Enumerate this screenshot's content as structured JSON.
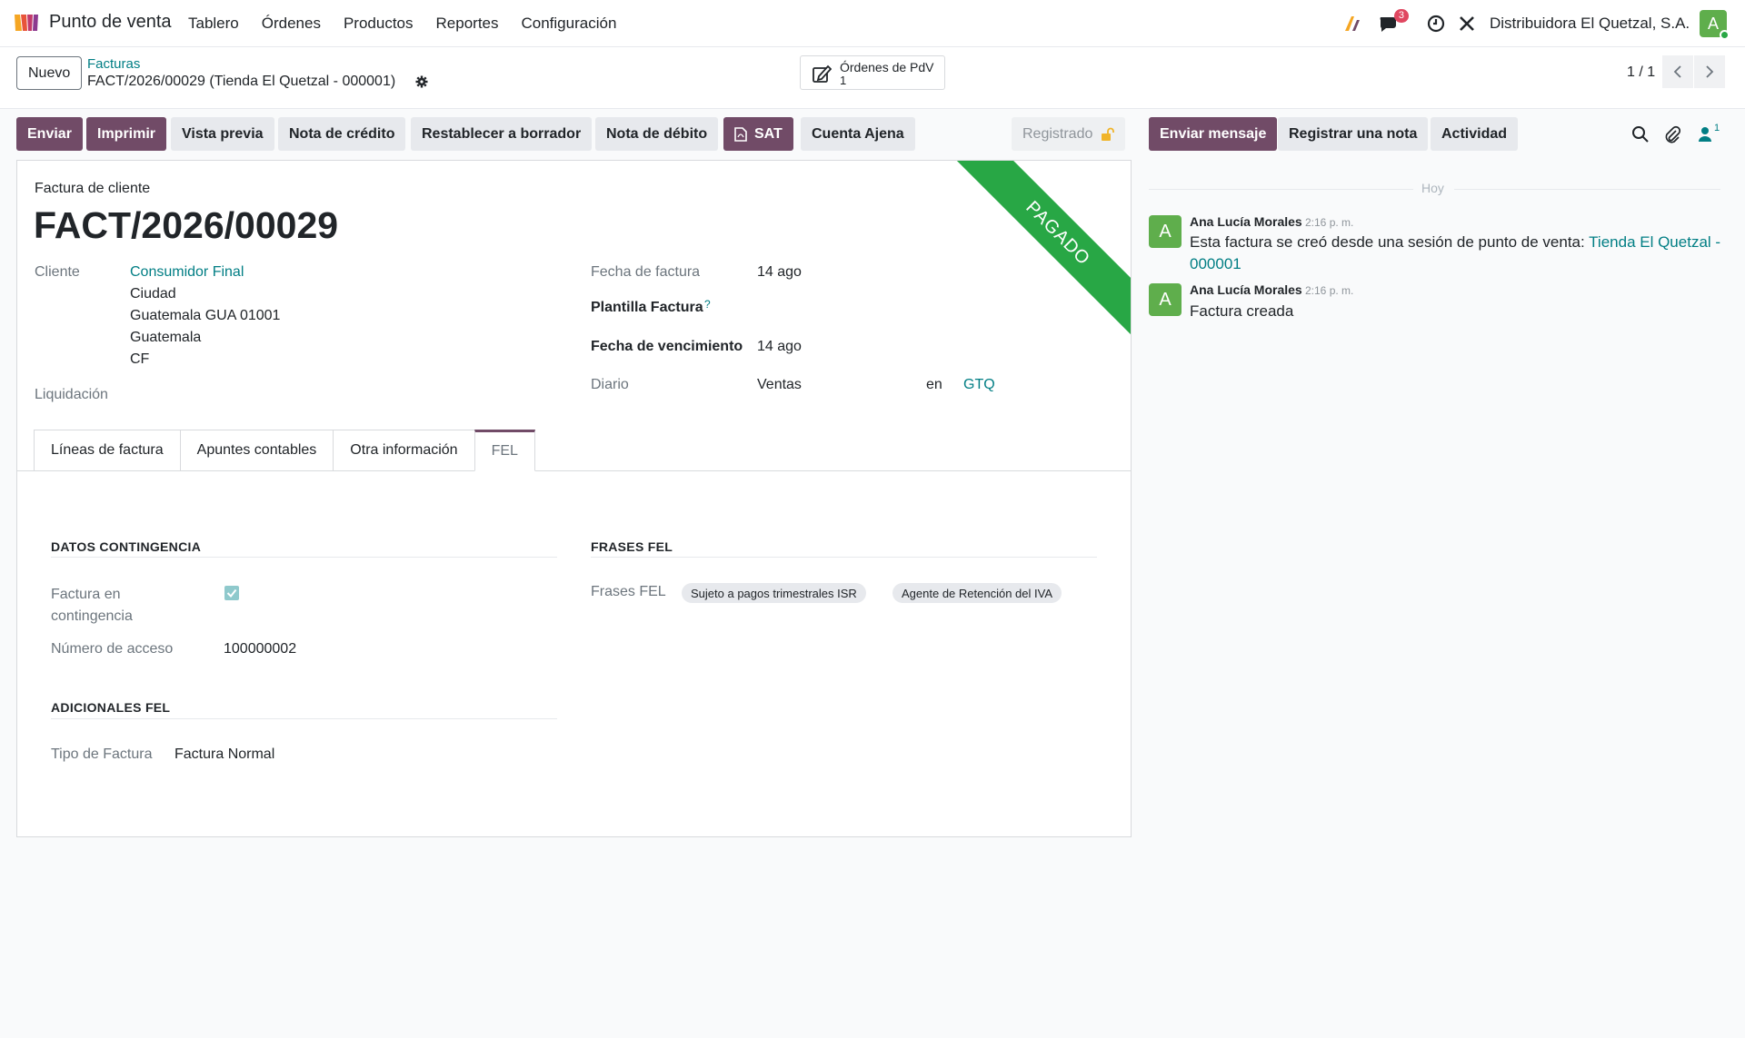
{
  "navbar": {
    "app_name": "Punto de venta",
    "menu": [
      "Tablero",
      "Órdenes",
      "Productos",
      "Reportes",
      "Configuración"
    ],
    "messages_badge": "3",
    "company": "Distribuidora El Quetzal, S.A.",
    "user_initial": "A"
  },
  "control": {
    "new_label": "Nuevo",
    "breadcrumb_parent": "Facturas",
    "breadcrumb_current": "FACT/2026/00029 (Tienda El Quetzal - 000001)",
    "smart_button_title": "Órdenes de PdV",
    "smart_button_count": "1",
    "pager": "1 / 1"
  },
  "actions": {
    "send": "Enviar",
    "print": "Imprimir",
    "preview": "Vista previa",
    "credit_note": "Nota de crédito",
    "reset_draft": "Restablecer a borrador",
    "debit_note": "Nota de débito",
    "sat": "SAT",
    "third_party": "Cuenta Ajena",
    "status": "Registrado"
  },
  "form": {
    "ribbon": "PAGADO",
    "subtitle": "Factura de cliente",
    "title": "FACT/2026/00029",
    "customer_label": "Cliente",
    "customer_name": "Consumidor Final",
    "address": [
      "Ciudad",
      "Guatemala GUA 01001",
      "Guatemala",
      "CF"
    ],
    "liquidation_label": "Liquidación",
    "invoice_date_label": "Fecha de factura",
    "invoice_date": "14 ago",
    "template_label": "Plantilla Factura",
    "template_help": "?",
    "due_date_label": "Fecha de vencimiento",
    "due_date": "14 ago",
    "journal_label": "Diario",
    "journal": "Ventas",
    "currency_prefix": "en",
    "currency": "GTQ",
    "tabs": [
      "Líneas de factura",
      "Apuntes contables",
      "Otra información",
      "FEL"
    ],
    "contingency_section": "DATOS CONTINGENCIA",
    "contingency_label": "Factura en contingencia",
    "contingency_checked": true,
    "access_number_label": "Número de acceso",
    "access_number": "100000002",
    "additional_section": "ADICIONALES FEL",
    "invoice_type_label": "Tipo de Factura",
    "invoice_type": "Factura Normal",
    "phrases_section": "FRASES FEL",
    "phrases_label": "Frases FEL",
    "phrases": [
      "Sujeto a pagos trimestrales ISR",
      "Agente de Retención del IVA"
    ]
  },
  "chatter": {
    "send_message": "Enviar mensaje",
    "log_note": "Registrar una nota",
    "activity": "Actividad",
    "followers_count": "1",
    "today": "Hoy",
    "messages": [
      {
        "initial": "A",
        "author": "Ana Lucía Morales",
        "time": "2:16 p. m.",
        "body": "Esta factura se creó desde una sesión de punto de venta:",
        "link": "Tienda El Quetzal - 000001"
      },
      {
        "initial": "A",
        "author": "Ana Lucía Morales",
        "time": "2:16 p. m.",
        "body": "Factura creada"
      }
    ]
  }
}
